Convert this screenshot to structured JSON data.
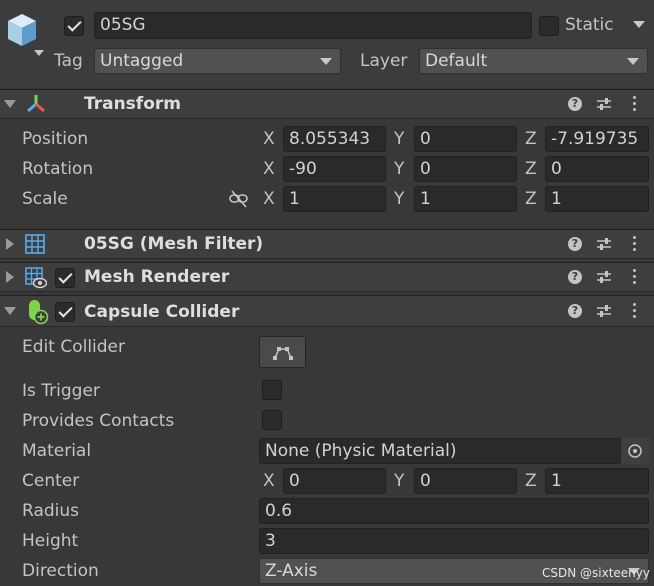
{
  "object": {
    "name": "05SG",
    "active": true,
    "static_label": "Static",
    "static_checked": false,
    "tag_label": "Tag",
    "tag_value": "Untagged",
    "layer_label": "Layer",
    "layer_value": "Default"
  },
  "transform": {
    "title": "Transform",
    "position_label": "Position",
    "rotation_label": "Rotation",
    "scale_label": "Scale",
    "axis_x": "X",
    "axis_y": "Y",
    "axis_z": "Z",
    "position": {
      "x": "8.055343",
      "y": "0",
      "z": "-7.919735"
    },
    "rotation": {
      "x": "-90",
      "y": "0",
      "z": "0"
    },
    "scale": {
      "x": "1",
      "y": "1",
      "z": "1"
    }
  },
  "mesh_filter": {
    "title": "05SG (Mesh Filter)"
  },
  "mesh_renderer": {
    "title": "Mesh Renderer",
    "enabled": true
  },
  "capsule_collider": {
    "title": "Capsule Collider",
    "enabled": true,
    "edit_collider_label": "Edit Collider",
    "is_trigger_label": "Is Trigger",
    "is_trigger": false,
    "provides_contacts_label": "Provides Contacts",
    "provides_contacts": false,
    "material_label": "Material",
    "material_value": "None (Physic Material)",
    "center_label": "Center",
    "center": {
      "x": "0",
      "y": "0",
      "z": "1"
    },
    "radius_label": "Radius",
    "radius_value": "0.6",
    "height_label": "Height",
    "height_value": "3",
    "direction_label": "Direction",
    "direction_value": "Z-Axis"
  },
  "watermark": "CSDN @sixteenyy",
  "colors": {
    "background": "#383838",
    "header": "#3e3e3e",
    "field": "#2a2a2a",
    "transform_icon_red": "#e8594d",
    "transform_icon_green": "#7fd44b",
    "transform_icon_blue": "#5aa9f0",
    "collider_icon_green": "#7fd44b"
  },
  "icons": [
    "gameobject-cube-icon",
    "transform-axes-icon",
    "mesh-filter-grid-icon",
    "mesh-renderer-icon",
    "capsule-collider-icon",
    "help-icon",
    "presets-sliders-icon",
    "kebab-menu-icon",
    "link-scale-icon",
    "edit-collider-icon",
    "object-picker-icon"
  ]
}
